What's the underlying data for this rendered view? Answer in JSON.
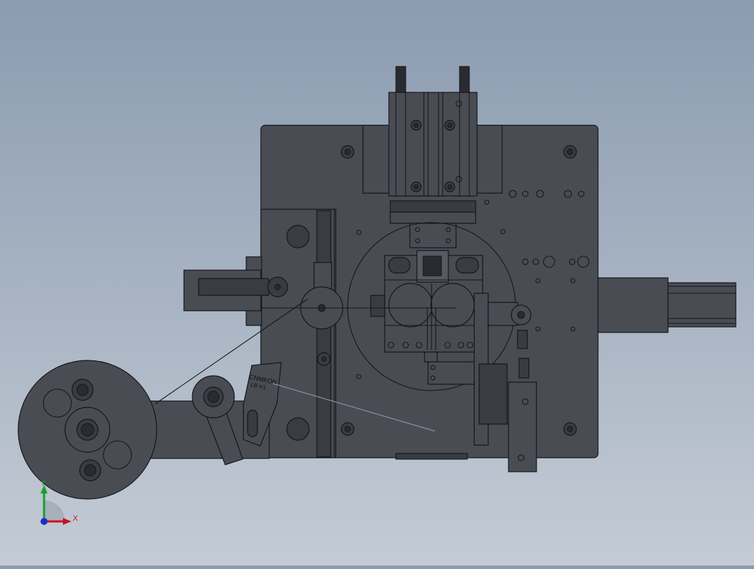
{
  "viewport": {
    "background_top": "#8b9bb0",
    "background_bottom": "#c4cbd5",
    "part_fill": "#4a4c54",
    "part_fill_dark": "#3a3c43",
    "edge_color": "#15161a"
  },
  "labels": {
    "engraved_line1": "CNMKON",
    "engraved_line2": "LB-V1"
  },
  "triad": {
    "x_label": "X",
    "y_label": "Y",
    "x_color": "#c8141e",
    "y_color": "#12a02a",
    "z_color": "#1c2cc8"
  }
}
